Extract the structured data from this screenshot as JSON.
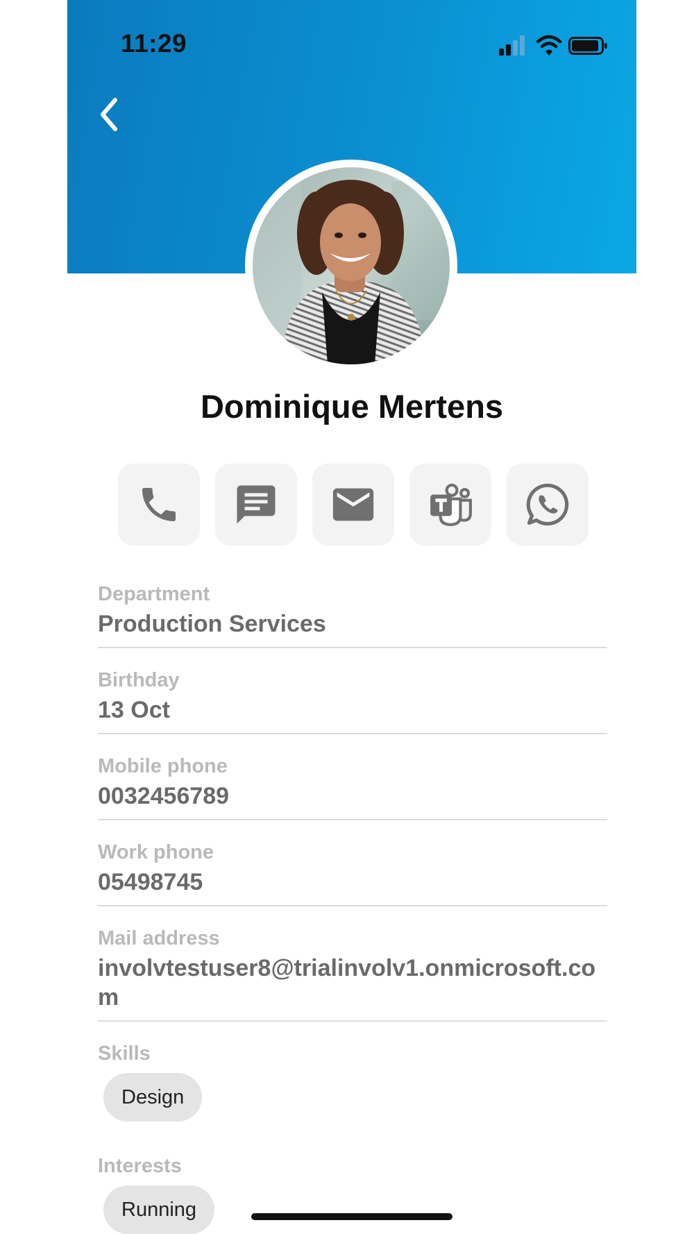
{
  "status_bar": {
    "time": "11:29",
    "icons": [
      "cellular-signal-icon",
      "wifi-icon",
      "battery-icon"
    ]
  },
  "header": {
    "background_start": "#0a7bbd",
    "background_end": "#0aa8e6",
    "back_icon": "chevron-left-icon"
  },
  "profile": {
    "name": "Dominique Mertens"
  },
  "actions": [
    {
      "icon": "phone-icon"
    },
    {
      "icon": "message-icon"
    },
    {
      "icon": "mail-icon"
    },
    {
      "icon": "teams-icon"
    },
    {
      "icon": "whatsapp-icon"
    }
  ],
  "fields": [
    {
      "label": "Department",
      "value": "Production Services"
    },
    {
      "label": "Birthday",
      "value": "13 Oct"
    },
    {
      "label": "Mobile phone",
      "value": "0032456789"
    },
    {
      "label": "Work phone",
      "value": "05498745"
    },
    {
      "label": "Mail address",
      "value": "involvtestuser8@trialinvolv1.onmicrosoft.com"
    }
  ],
  "skills": {
    "label": "Skills",
    "chips": [
      "Design"
    ]
  },
  "interests": {
    "label": "Interests",
    "chips": [
      "Running"
    ]
  },
  "colors": {
    "label_gray": "#b9b9b9",
    "value_gray": "#6a6a6a",
    "action_background": "#f3f3f3",
    "icon_gray": "#707070",
    "chip_background": "#e4e4e4"
  }
}
